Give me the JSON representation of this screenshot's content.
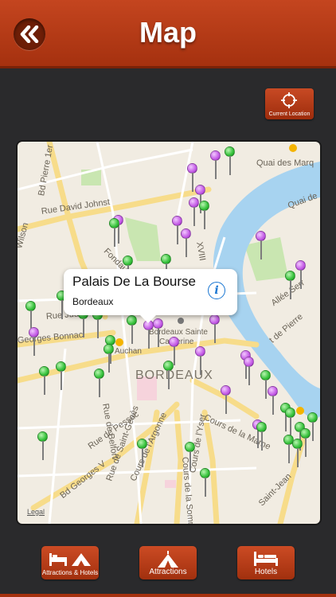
{
  "header": {
    "title": "Map",
    "back_icon": "double-chevron-left-icon"
  },
  "current_location": {
    "label": "Current Location",
    "icon": "crosshair-icon"
  },
  "map": {
    "labels": {
      "quai_des_marques": "Quai des Marq",
      "quai_de": "Quai de",
      "bd_pierre": "Bd Pierre 1er",
      "rue_david_johnston": "Rue David Johnst",
      "wilson": "Wilson",
      "cours_fondaudege": "Fondaud",
      "rue_judaique": "Rue Juda",
      "georges_bonnac": "Georges Bonnac",
      "auchan": "Auchan",
      "bordeaux_sainte_catherine": "Bordeaux Sainte",
      "catherine": "Catherine",
      "bordeaux": "BORDEAUX",
      "rue_de_belfort": "Rue de Belfort",
      "rue_de_pessac": "Rue de Pessac",
      "bd_georges_v": "Bd Georges V",
      "rue_de_saint_genes": "Rue de Saint-Genès",
      "cours_argonne": "Cours de l'Argonne",
      "cours_somme": "Cours de la Somme",
      "cours_yser": "Cours de l'Yser",
      "cours_marne": "Cours de la Marne",
      "quai_de_pierre": "t de Pierre",
      "allee_serr": "Allée Serr",
      "saint_jean": "Saint-Jean",
      "xviii": "XVIII"
    },
    "legal": "Legal"
  },
  "callout": {
    "title": "Palais De La Bourse",
    "subtitle": "Bordeaux",
    "info_icon": "info-icon"
  },
  "tabs": [
    {
      "label": "Attractions & Hotels",
      "icon": "bed-tent-icon"
    },
    {
      "label": "Attractions",
      "icon": "tent-icon"
    },
    {
      "label": "Hotels",
      "icon": "bed-icon"
    }
  ],
  "colors": {
    "accent": "#b83c17",
    "water": "#a7d3f0",
    "park": "#c9e6b1",
    "pin_green": "#35c13a",
    "pin_purple": "#c45be6"
  }
}
